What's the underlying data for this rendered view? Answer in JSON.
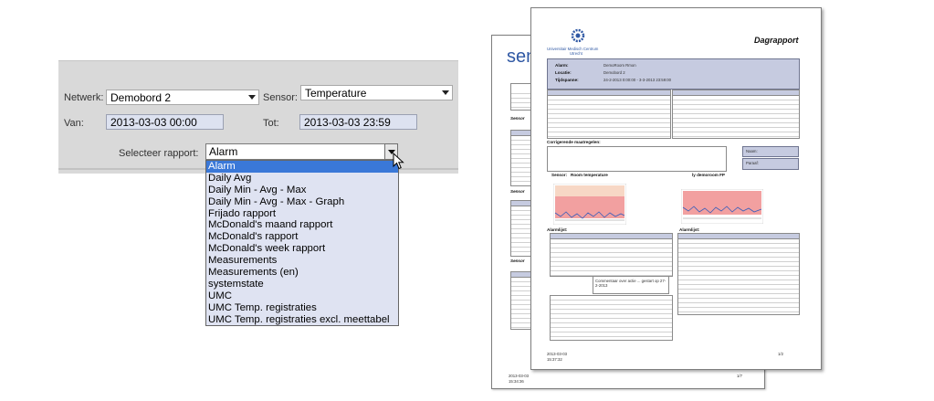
{
  "form": {
    "netwerk_label": "Netwerk:",
    "netwerk_value": "Demobord 2",
    "sensor_label": "Sensor:",
    "sensor_value": "Temperature",
    "van_label": "Van:",
    "van_value": "2013-03-03 00:00",
    "tot_label": "Tot:",
    "tot_value": "2013-03-03 23:59",
    "rapport_label": "Selecteer rapport:",
    "rapport_value": "Alarm",
    "options": [
      "Alarm",
      "Daily Avg",
      "Daily Min - Avg - Max",
      "Daily Min - Avg - Max - Graph",
      "Frijado rapport",
      "McDonald's maand rapport",
      "McDonald's rapport",
      "McDonald's week rapport",
      "Measurements",
      "Measurements (en)",
      "systemstate",
      "UMC",
      "UMC Temp. registraties",
      "UMC Temp. registraties excl. meettabel"
    ]
  },
  "back_report": {
    "logo_text": "sen",
    "section_1": "Sensor",
    "section_2": "Sensor",
    "section_3": "Sensor",
    "footer_date": "2013-03-03",
    "footer_time": "15:34:36",
    "page": "1/7"
  },
  "front_report": {
    "org_name": "Universitair Medisch Centrum",
    "org_city": "Utrecht",
    "title": "Dagrapport",
    "alarm_label": "Alarm:",
    "alarm_value": "DemoRoom Rmon",
    "locatie_label": "Locatie:",
    "locatie_value": "Demobord 2",
    "tijd_label": "Tijdspanne:",
    "tijd_value": "24-2-2013  0:00:00 - 3-3-2013  23:59:00",
    "corr_label": "Corrigerende maatregelen:",
    "naam_label": "Naam:",
    "paraaf_label": "Paraaf:",
    "sensor_label": "Sensor:",
    "sensor_left": "Room temperature",
    "sensor_right": "ly demoroom FP",
    "alarm_left": "Alarmlijst:",
    "alarm_right": "Alarmlijst:",
    "comment": "Commentaar over actie ... gestart op 27-2-2013",
    "footer_date": "2013-03-03",
    "footer_time": "15:37:32",
    "page": "1/2"
  },
  "colors": {
    "panel_bg": "#d9d9d9",
    "input_bg": "#dde2f0",
    "dropdown_bg": "#dfe3f2",
    "highlight": "#3a78d8",
    "report_header_bg": "#c6cbe0",
    "chart_fill": "#f2a0a0",
    "logo_blue": "#2f58a4"
  }
}
